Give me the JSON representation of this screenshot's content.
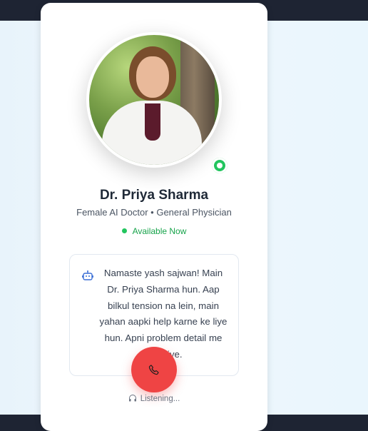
{
  "doctor": {
    "name": "Dr. Priya Sharma",
    "subtitle": "Female AI Doctor • General Physician",
    "availability": "Available Now"
  },
  "message": {
    "text": "Namaste yash sajwan! Main Dr. Priya Sharma hun. Aap bilkul tension na lein, main yahan aapki help karne ke liye hun. Apni problem detail me batayiye."
  },
  "call": {
    "status": "Listening..."
  },
  "colors": {
    "accent_red": "#ef4444",
    "online_green": "#22c55e",
    "available_text": "#16a34a",
    "dark_header": "#1e2433"
  },
  "icons": {
    "bot": "robot-icon",
    "phone": "phone-icon",
    "headphones": "headphones-icon"
  }
}
